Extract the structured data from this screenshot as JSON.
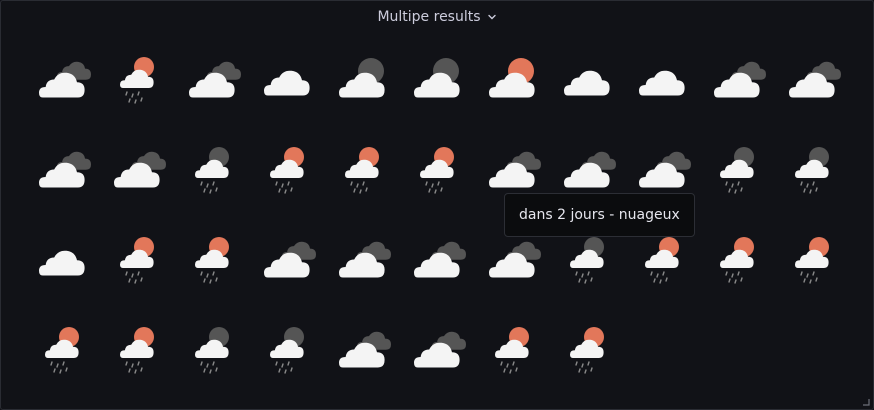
{
  "panel": {
    "title": "Multipe results"
  },
  "tooltip": {
    "text": "dans 2 jours - nuageux"
  },
  "colors": {
    "background": "#111217",
    "cloud": "#f4f4f4",
    "dark_cloud": "#555555",
    "sun": "#e2775a",
    "moon": "#555555",
    "rain": "#8a8a8a"
  },
  "icon_types": {
    "A": "cloudy-dark-cloud-icon",
    "B": "rain-sun-icon",
    "C": "cloudy-icon",
    "D": "cloud-moon-icon",
    "E": "cloud-sun-icon",
    "F": "rain-moon-icon"
  },
  "forecast_rows": [
    [
      "A",
      "B",
      "A",
      "C",
      "D",
      "D",
      "E",
      "C",
      "C",
      "A",
      "A"
    ],
    [
      "A",
      "A",
      "F",
      "B",
      "B",
      "B",
      "A",
      "A",
      "A",
      "F",
      "F"
    ],
    [
      "C",
      "B",
      "B",
      "A",
      "A",
      "A",
      "A",
      "F",
      "B",
      "B",
      "B"
    ],
    [
      "B",
      "B",
      "F",
      "F",
      "A",
      "A",
      "B",
      "B"
    ]
  ]
}
